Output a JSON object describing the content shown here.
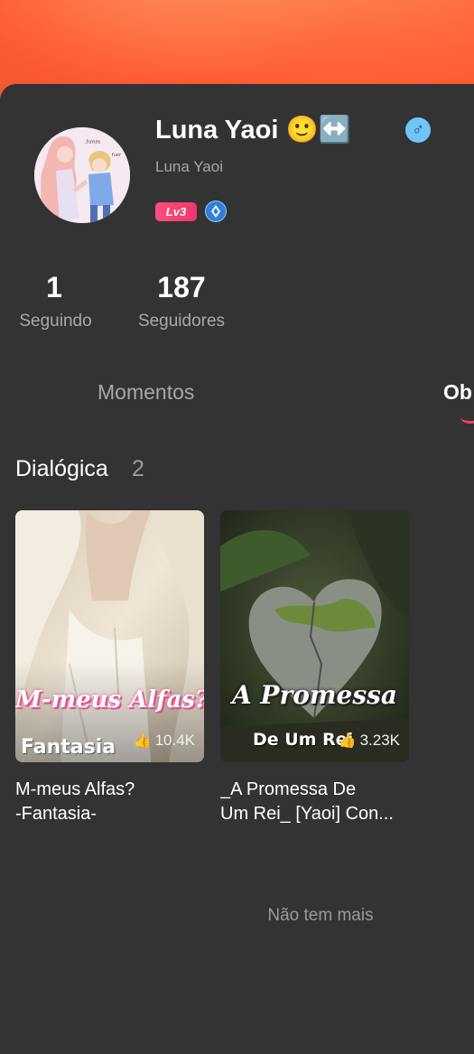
{
  "profile": {
    "name": "Luna Yaoi 🙂↔️",
    "username": "Luna Yaoi",
    "gender_symbol": "♂",
    "level": "Lv3"
  },
  "stats": [
    {
      "value": "1",
      "label": "Seguindo"
    },
    {
      "value": "187",
      "label": "Seguidores"
    }
  ],
  "tabs": [
    {
      "label": "Momentos",
      "active": false
    },
    {
      "label": "Ob",
      "active": true
    }
  ],
  "section": {
    "title": "Dialógica",
    "count": "2"
  },
  "works": [
    {
      "cover_title": "M-meus Alfas?",
      "cover_subtitle": "Fantasia",
      "views": "10.4K",
      "title_line1": "M-meus Alfas?",
      "title_line2": "-Fantasia-"
    },
    {
      "cover_title": "A Promessa",
      "cover_subtitle": "De Um Rei",
      "views": "3.23K",
      "title_line1": "_A Promessa De",
      "title_line2": "Um Rei_ [Yaoi] Con..."
    }
  ],
  "footer": {
    "end_text": "Não tem mais"
  },
  "colors": {
    "banner": "#ff6a3d",
    "background": "#333333",
    "accent": "#ff3d6e",
    "level_badge": "#f0366a",
    "gender_badge": "#6ec6f5"
  }
}
